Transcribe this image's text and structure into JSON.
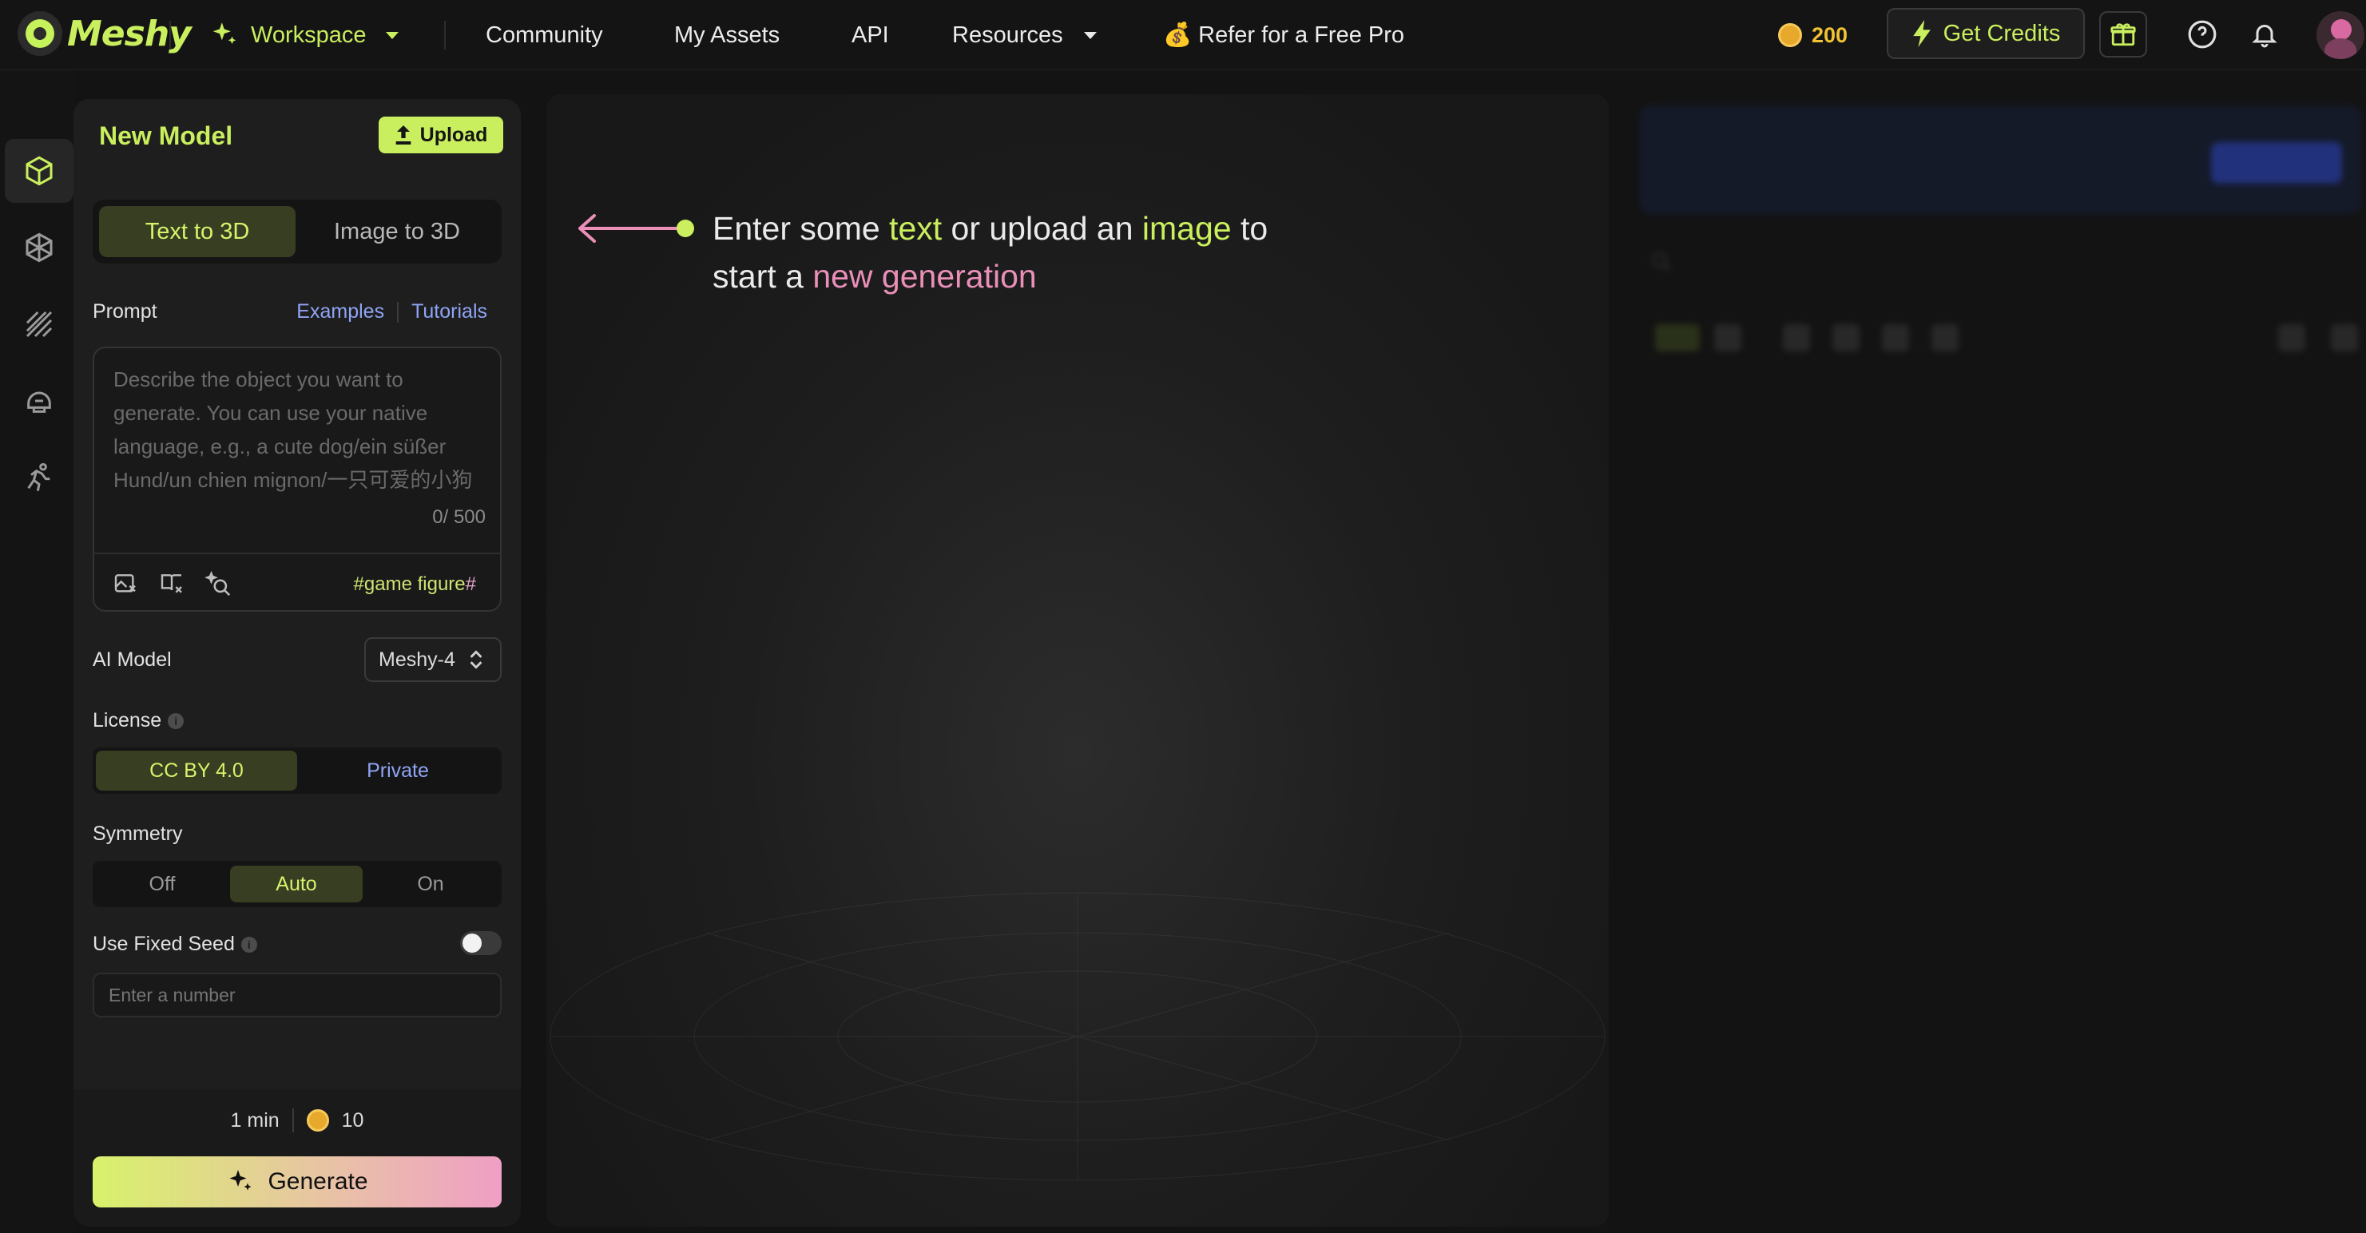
{
  "brand": {
    "name": "Meshy"
  },
  "nav": {
    "workspace": "Workspace",
    "community": "Community",
    "my_assets": "My Assets",
    "api": "API",
    "resources": "Resources",
    "refer": "💰 Refer for a Free Pro",
    "credits": "200",
    "get_credits": "Get Credits"
  },
  "rail": {
    "items": [
      "cube-icon",
      "model-mesh-icon",
      "texture-icon",
      "helmet-icon",
      "running-figure-icon"
    ],
    "active_index": 0
  },
  "panel": {
    "title": "New Model",
    "upload_label": "Upload",
    "tabs": [
      {
        "label": "Text to 3D",
        "active": true
      },
      {
        "label": "Image to 3D",
        "active": false
      }
    ],
    "prompt_label": "Prompt",
    "examples_label": "Examples",
    "tutorials_label": "Tutorials",
    "prompt_placeholder": "Describe the object you want to generate. You can use your native language, e.g., a cute dog/ein süßer Hund/un chien mignon/一只可爱的小狗",
    "prompt_value": "",
    "prompt_counter": "0/ 500",
    "tag_prefix": "#game figure",
    "tag_suffix": "#",
    "ai_model_label": "AI Model",
    "ai_model_value": "Meshy-4",
    "license_label": "License",
    "license_options": [
      "CC BY 4.0",
      "Private"
    ],
    "license_selected": "CC BY 4.0",
    "symmetry_label": "Symmetry",
    "symmetry_options": [
      "Off",
      "Auto",
      "On"
    ],
    "symmetry_selected": "Auto",
    "fixed_seed_label": "Use Fixed Seed",
    "fixed_seed_enabled": false,
    "seed_placeholder": "Enter a number",
    "estimate_time": "1 min",
    "estimate_cost": "10",
    "generate_label": "Generate"
  },
  "canvas": {
    "msg_part1": "Enter some ",
    "msg_text": "text",
    "msg_part2": " or upload an ",
    "msg_image": "image",
    "msg_part3": " to",
    "msg_part4": "start a ",
    "msg_new_gen": "new generation"
  },
  "colors": {
    "accent_green": "#c9ef5e",
    "accent_pink": "#e98fb8",
    "link_blue": "#8fa4f5",
    "background": "#131313",
    "panel": "#1e1e1e"
  }
}
